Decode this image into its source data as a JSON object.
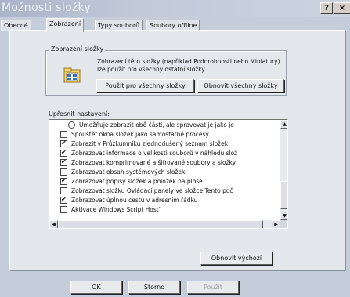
{
  "window": {
    "title": "Možnosti složky",
    "help_label": "?",
    "close_label": "×"
  },
  "tabs": [
    {
      "label": "Obecné",
      "active": false
    },
    {
      "label": "Zobrazení",
      "active": true
    },
    {
      "label": "Typy souborů",
      "active": false
    },
    {
      "label": "Soubory offline",
      "active": false
    }
  ],
  "folder_views": {
    "title": "Zobrazení složky",
    "description": "Zobrazení této složky (například Podorobnosti nebo Miniatury) lze použít pro všechny ostatní složky.",
    "apply_all_label": "Použít pro všechny složky",
    "reset_all_label": "Obnovit všechny složky"
  },
  "advanced": {
    "label": "Upřesnit nastavení:",
    "items": [
      {
        "text": "Umožňuje zobrazit obě části, ale spravovat je jako je",
        "kind": "radio",
        "checked": false,
        "indent": true
      },
      {
        "text": "Spouštět okna složek jako samostatné procesy",
        "kind": "checkbox",
        "checked": false,
        "indent": false
      },
      {
        "text": "Zobrazit v Průzkumníku zjednodušený seznam složek",
        "kind": "checkbox",
        "checked": true,
        "indent": false
      },
      {
        "text": "Zobrazovat informace o velikosti souborů v náhledu slož",
        "kind": "checkbox",
        "checked": true,
        "indent": false
      },
      {
        "text": "Zobrazovat komprimované a šifrované soubory a složky",
        "kind": "checkbox",
        "checked": true,
        "indent": false
      },
      {
        "text": "Zobrazovat obsah systémových složek",
        "kind": "checkbox",
        "checked": false,
        "indent": false
      },
      {
        "text": "Zobrazovat popisy složek a položek na ploše",
        "kind": "checkbox",
        "checked": true,
        "indent": false
      },
      {
        "text": "Zobrazovat složku Ovládací panely ve složce Tento poč",
        "kind": "checkbox",
        "checked": false,
        "indent": false
      },
      {
        "text": "Zobrazovat úplnou cestu v adresním řádku",
        "kind": "checkbox",
        "checked": true,
        "indent": false
      },
      {
        "text": "Aktivace Windows Script Host\"",
        "kind": "checkbox",
        "checked": false,
        "indent": false
      }
    ],
    "restore_defaults_label": "Obnovit výchozí"
  },
  "dialog_buttons": {
    "ok_label": "OK",
    "cancel_label": "Storno",
    "apply_label": "Použít"
  },
  "colors": {
    "title_bar": "#aab4c8",
    "panel": "#e4e7ec",
    "disabled_text": "#a0a4aa"
  }
}
